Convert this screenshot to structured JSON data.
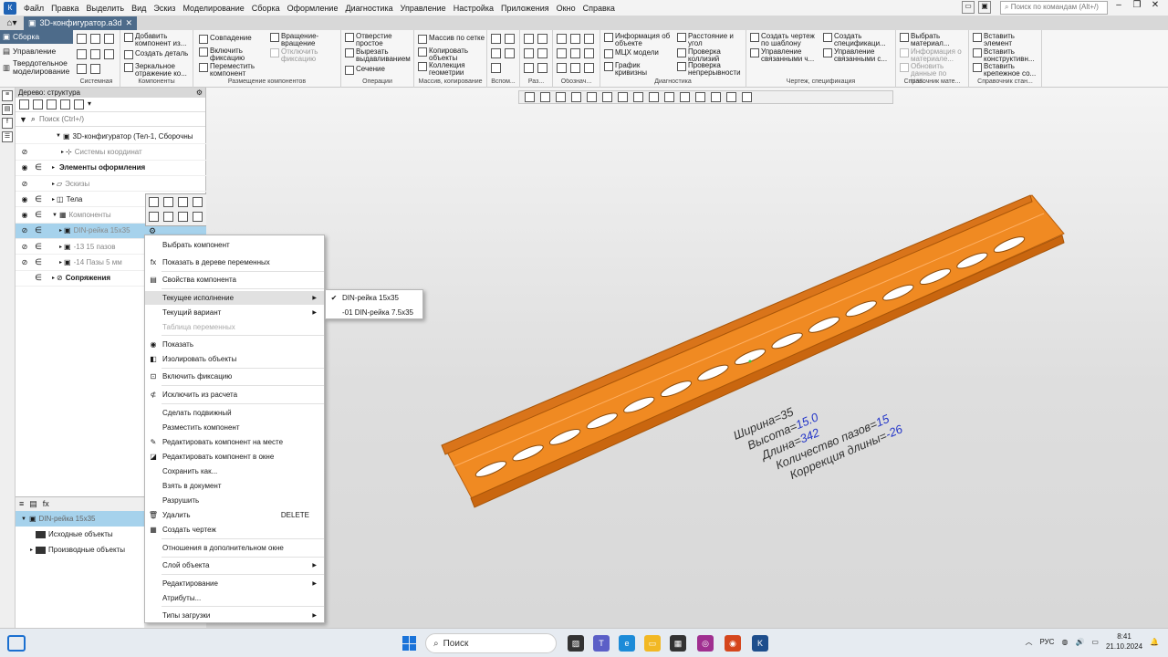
{
  "menubar": {
    "items": [
      "Файл",
      "Правка",
      "Выделить",
      "Вид",
      "Эскиз",
      "Моделирование",
      "Сборка",
      "Оформление",
      "Диагностика",
      "Управление",
      "Настройка",
      "Приложения",
      "Окно",
      "Справка"
    ],
    "command_search_placeholder": "Поиск по командам (Alt+/)"
  },
  "tabs": {
    "document": "3D-конфигуратор.a3d"
  },
  "ribbon": {
    "modes": [
      "Сборка",
      "Управление",
      "Твердотельное моделирование"
    ],
    "groups": {
      "system": {
        "label": "Системная"
      },
      "components": {
        "label": "Компоненты",
        "buttons": [
          "Добавить компонент из...",
          "Создать деталь",
          "Зеркальное отражение ко..."
        ]
      },
      "placement": {
        "label": "Размещение компонентов",
        "buttons": [
          "Совпадение",
          "Включить фиксацию",
          "Переместить компонент",
          "Вращение-вращение",
          "Отключить фиксацию"
        ]
      },
      "operations": {
        "label": "Операции",
        "buttons": [
          "Отверстие простое",
          "Вырезать выдавливанием",
          "Сечение"
        ]
      },
      "array": {
        "label": "Массив, копирование",
        "buttons": [
          "Массив по сетке",
          "Копировать объекты",
          "Коллекция геометрии"
        ]
      },
      "aux": {
        "label": "Вспом..."
      },
      "sizes": {
        "label": "Раз..."
      },
      "notation": {
        "label": "Обознач..."
      },
      "diagnostics": {
        "label": "Диагностика",
        "buttons": [
          "Информация об объекте",
          "МЦХ модели",
          "График кривизны",
          "Расстояние и угол",
          "Проверка коллизий",
          "Проверка непрерывности"
        ]
      },
      "drawing": {
        "label": "Чертеж, спецификация",
        "buttons": [
          "Создать чертеж по шаблону",
          "Управление связанными ч...",
          "Создать спецификаци...",
          "Управление связанными с..."
        ]
      },
      "reference": {
        "label": "Справочник мате...",
        "buttons": [
          "Выбрать материал...",
          "Информация о материале...",
          "Обновить данные по мат..."
        ]
      },
      "standard": {
        "label": "Справочник стан...",
        "buttons": [
          "Вставить элемент",
          "Вставить конструктивн...",
          "Вставить крепежное со..."
        ]
      }
    }
  },
  "tree_panel": {
    "title": "Дерево: структура",
    "search_placeholder": "Поиск (Ctrl+/)",
    "rows": [
      {
        "label": "3D-конфигуратор (Тел-1, Сборочны",
        "style": "normal"
      },
      {
        "label": "Системы координат",
        "style": "gray"
      },
      {
        "label": "Элементы оформления",
        "style": "bold"
      },
      {
        "label": "Эскизы",
        "style": "gray"
      },
      {
        "label": "Тела",
        "style": "normal"
      },
      {
        "label": "Компоненты",
        "style": "gray"
      },
      {
        "label": "DIN-рейка 15х35",
        "style": "gray"
      },
      {
        "label": "-13 15 пазов",
        "style": "gray"
      },
      {
        "label": "-14 Пазы 5 мм",
        "style": "gray"
      },
      {
        "label": "Сопряжения",
        "style": "bold"
      }
    ]
  },
  "bottom_panel": {
    "rows": [
      "DIN-рейка 15х35",
      "Исходные объекты",
      "Производные объекты"
    ]
  },
  "context_menu": {
    "items": [
      "Выбрать компонент",
      "Показать в дереве переменных",
      "Свойства компонента",
      "Текущее исполнение",
      "Текущий вариант",
      "Таблица переменных",
      "Показать",
      "Изолировать объекты",
      "Включить фиксацию",
      "Исключить из расчета",
      "Сделать подвижный",
      "Разместить компонент",
      "Редактировать компонент на месте",
      "Редактировать компонент в окне",
      "Сохранить как...",
      "Взять в документ",
      "Разрушить",
      "Удалить",
      "Создать чертеж",
      "Отношения в дополнительном окне",
      "Слой объекта",
      "Редактирование",
      "Атрибуты...",
      "Типы загрузки"
    ],
    "shortcut_delete": "DELETE"
  },
  "submenu": {
    "items": [
      "DIN-рейка 15х35",
      "-01 DIN-рейка 7.5х35"
    ]
  },
  "model_annotations": [
    {
      "name": "Ширина=",
      "value": "35"
    },
    {
      "name": "Высота=",
      "value": "15.0"
    },
    {
      "name": "Длина=",
      "value": "342"
    },
    {
      "name": "Количество пазов=",
      "value": "15"
    },
    {
      "name": "Коррекция длины=",
      "value": "-26"
    }
  ],
  "taskbar": {
    "search_label": "Поиск",
    "lang": "РУС",
    "time": "8:41",
    "date": "21.10.2024"
  },
  "colors": {
    "rail": "#f08a22",
    "accent": "#4d6b8a",
    "selection": "#a6d2ec",
    "annotation_value": "#2436c8"
  }
}
